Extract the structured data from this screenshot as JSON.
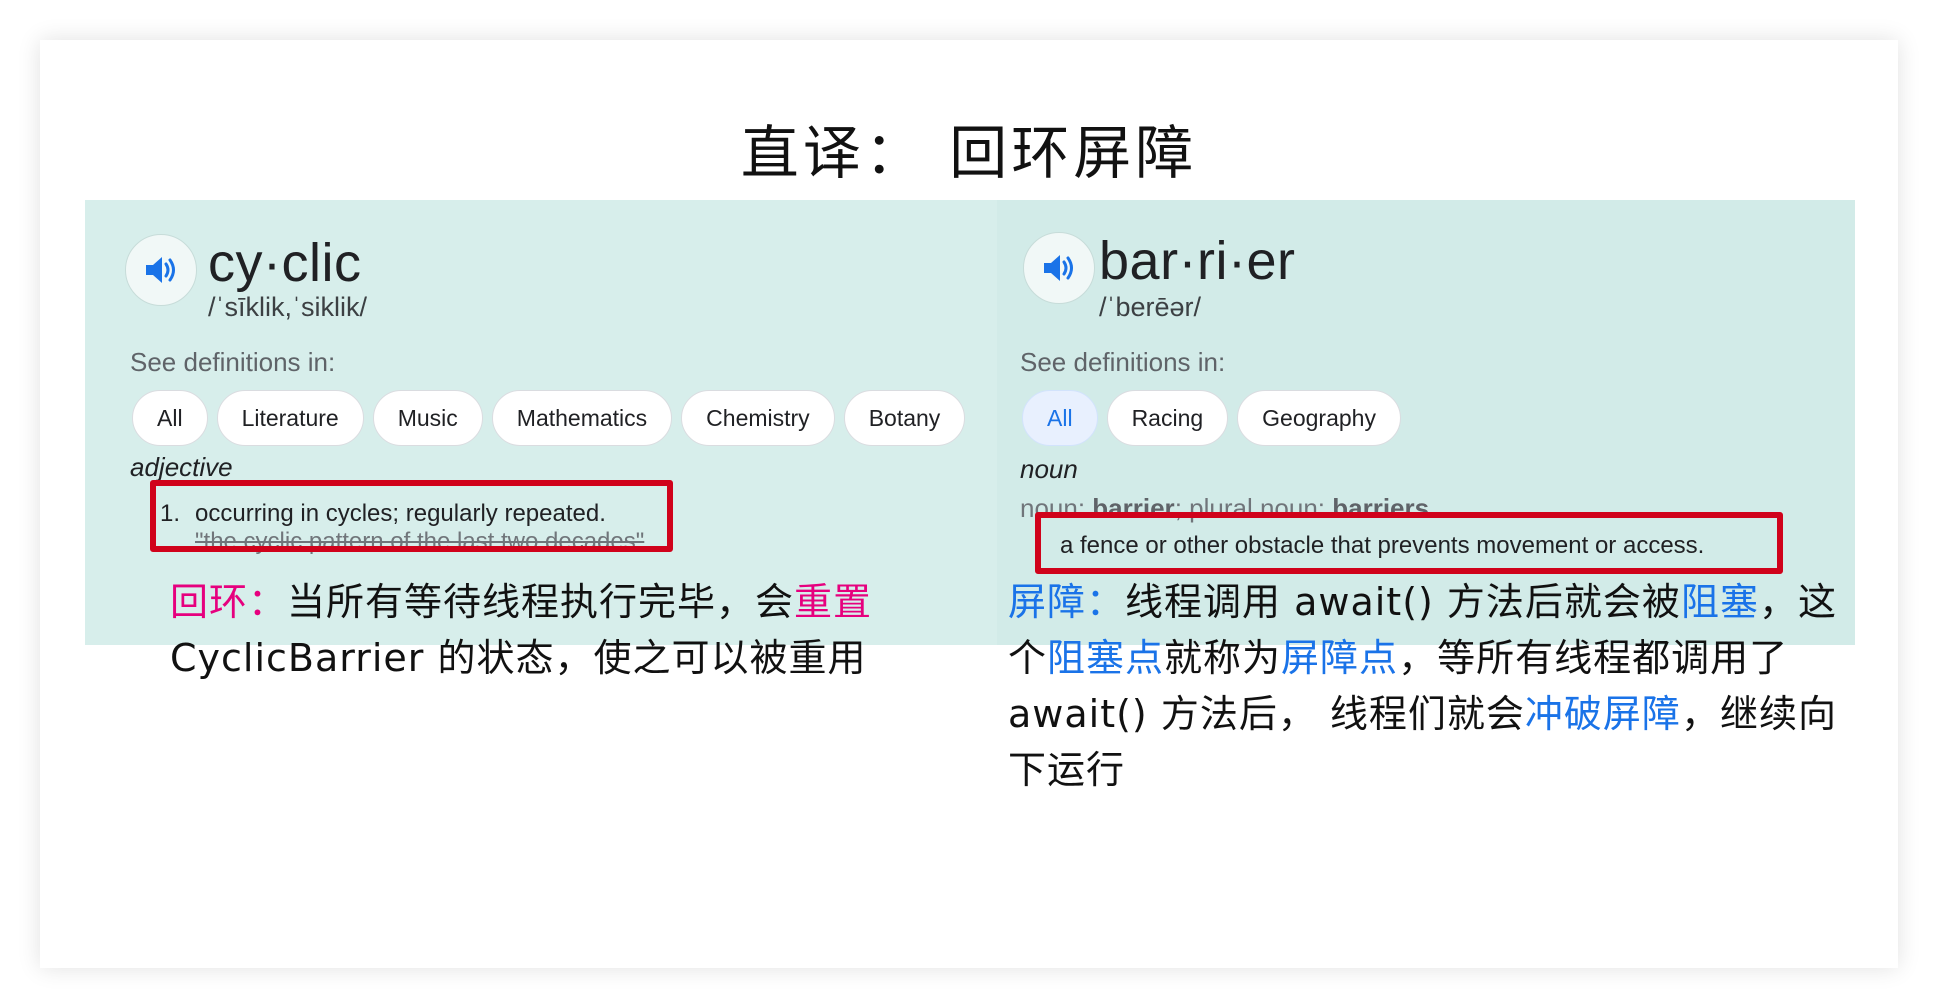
{
  "title": "直译：  回环屏障",
  "left": {
    "word": "cy·clic",
    "phonetic": "/ˈsīklik,ˈsiklik/",
    "see_label": "See definitions in:",
    "chips": [
      "All",
      "Literature",
      "Music",
      "Mathematics",
      "Chemistry",
      "Botany"
    ],
    "part_of_speech": "adjective",
    "def_number": "1.",
    "definition": "occurring in cycles; regularly repeated.",
    "example": "\"the cyclic pattern of the last two decades\""
  },
  "right": {
    "word": "bar·ri·er",
    "phonetic": "/ˈberēər/",
    "see_label": "See definitions in:",
    "chips": [
      "All",
      "Racing",
      "Geography"
    ],
    "part_of_speech": "noun",
    "noun_prefix": "noun: ",
    "noun_singular": "barrier",
    "noun_sep": "; plural noun: ",
    "noun_plural": "barriers",
    "definition": "a fence or other obstacle that prevents movement or access."
  },
  "notes": {
    "left": {
      "label": "回环：",
      "t1": "当所有等待线程执行完毕，会",
      "h1": "重置",
      "t2": "CyclicBarrier 的状态，使之可以被重用"
    },
    "right": {
      "label": "屏障：",
      "t1": "线程调用 await() 方法后就会被",
      "h1": "阻塞",
      "t2": "，这个",
      "h2": "阻塞点",
      "t3": "就称为",
      "h3": "屏障点",
      "t4": "，等所有线程都调用了 await() 方法后， 线程们就会",
      "h4": "冲破屏障",
      "t5": "，继续向下运行"
    }
  },
  "colors": {
    "highlight_pink": "#e6007e",
    "highlight_blue": "#1a73e8",
    "box_red": "#d0021b",
    "panel_bg": "#d7eeeb"
  }
}
